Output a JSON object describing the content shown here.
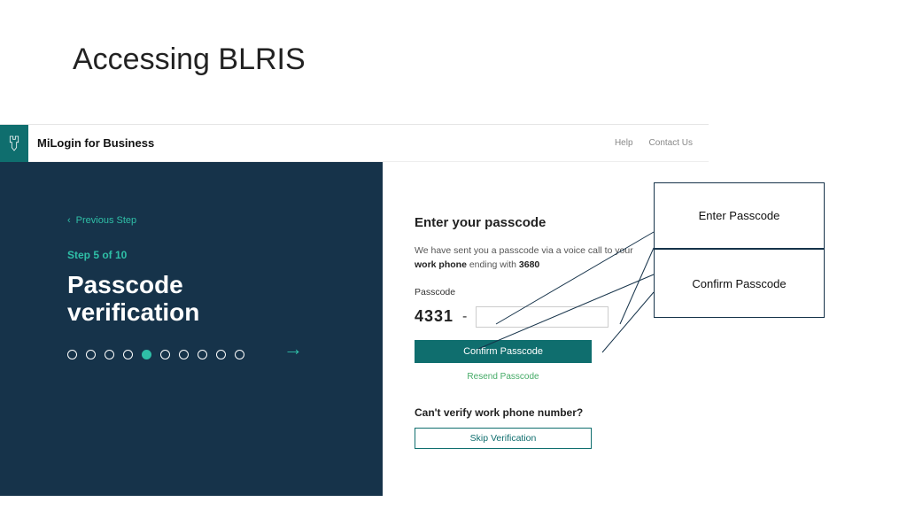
{
  "slide": {
    "title": "Accessing BLRIS"
  },
  "topbar": {
    "brand": "MiLogin for Business",
    "help": "Help",
    "contact": "Contact Us"
  },
  "left": {
    "prev": "Previous Step",
    "step_of": "Step 5 of 10",
    "title": "Passcode verification",
    "dots_total": 10,
    "dots_active_index": 4
  },
  "form": {
    "heading": "Enter your passcode",
    "desc_prefix": "We have sent you a passcode via a voice call to your",
    "desc_phone_label": "work phone",
    "desc_ending": "ending with",
    "desc_last4": "3680",
    "field_label": "Passcode",
    "prefix": "4331",
    "confirm": "Confirm Passcode",
    "resend": "Resend Passcode",
    "cant_verify": "Can't verify work phone number?",
    "skip": "Skip Verification"
  },
  "annotations": {
    "enter": "Enter Passcode",
    "confirm": "Confirm Passcode"
  }
}
